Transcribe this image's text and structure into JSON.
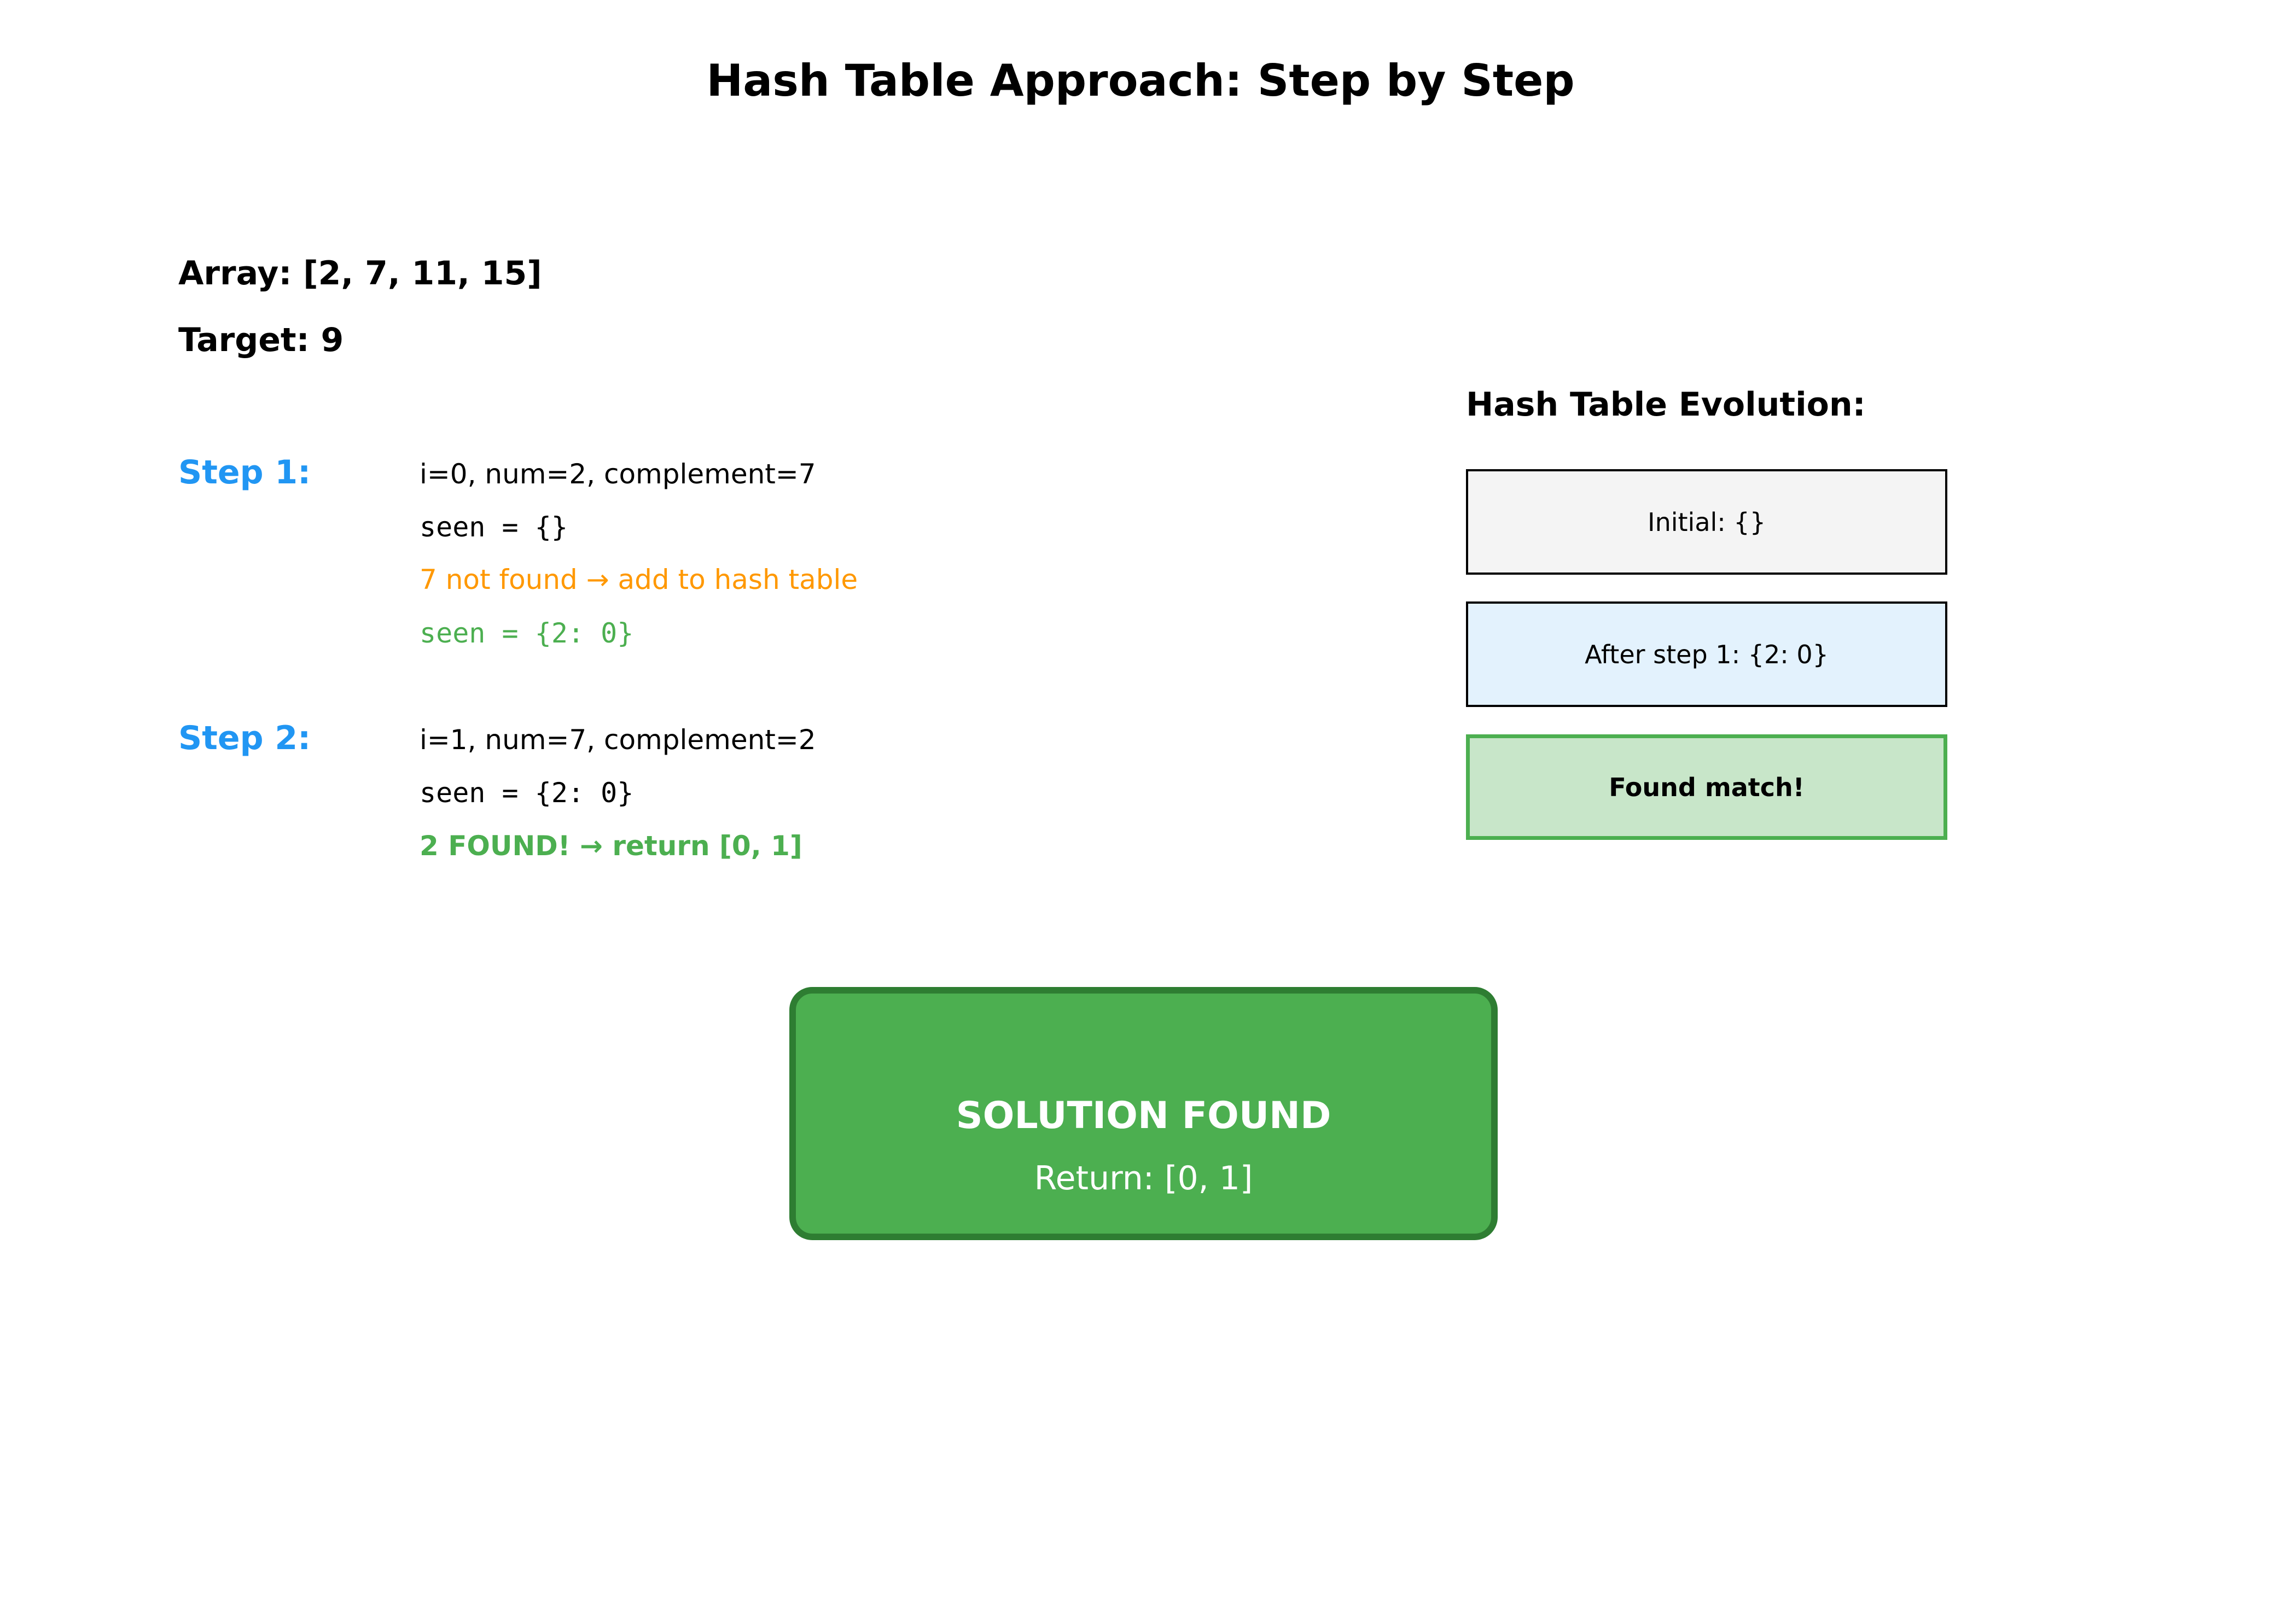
{
  "title": "Hash Table Approach: Step by Step",
  "array_label": "Array: [2, 7, 11, 15]",
  "target_label": "Target: 9",
  "steps": [
    {
      "label": "Step 1:",
      "lines": [
        "i=0, num=2, complement=7",
        "seen = {}",
        "7 not found → add to hash table",
        "seen = {2: 0}"
      ]
    },
    {
      "label": "Step 2:",
      "lines": [
        "i=1, num=7, complement=2",
        "seen = {2: 0}",
        "2 FOUND! → return [0, 1]"
      ]
    }
  ],
  "evolution": {
    "title": "Hash Table Evolution:",
    "boxes": [
      "Initial: {}",
      "After step 1: {2: 0}",
      "Found match!"
    ]
  },
  "solution": {
    "title": "SOLUTION FOUND",
    "return_text": "Return: [0, 1]"
  },
  "colors": {
    "step_label": "#2196F3",
    "not_found": "#FF9800",
    "found": "#4CAF50",
    "solution_fill": "#4CAF50",
    "solution_border": "#2E7D32",
    "box_initial": "#F4F4F4",
    "box_step1": "#E3F2FD",
    "box_found": "#C8E6C9"
  }
}
